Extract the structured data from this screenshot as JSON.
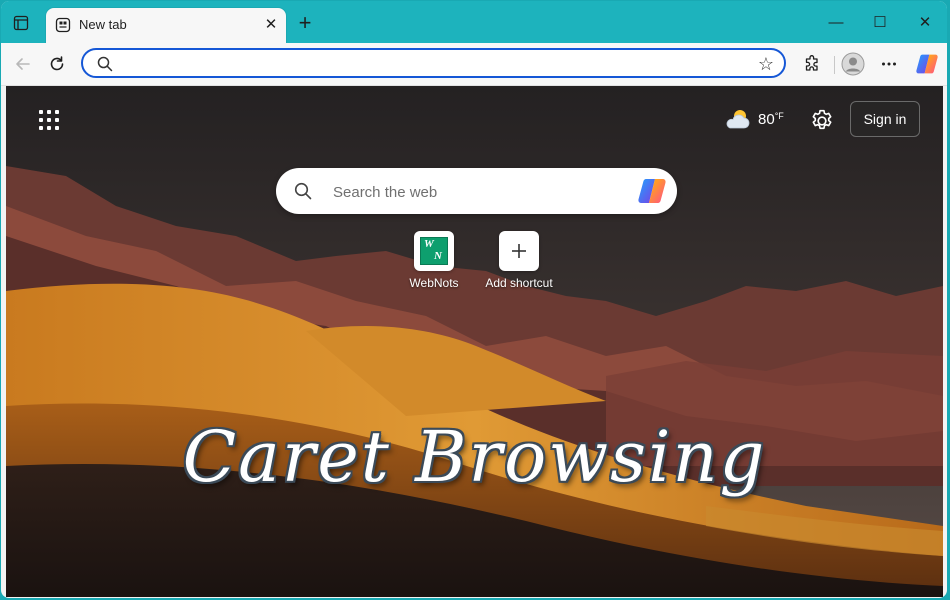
{
  "tab": {
    "title": "New tab",
    "close_symbol": "✕"
  },
  "new_tab_symbol": "+",
  "window_controls": {
    "minimize": "—",
    "maximize": "☐",
    "close": "✕"
  },
  "address_bar": {
    "value": "",
    "placeholder": ""
  },
  "toolbar_icons": [
    "back-arrow-icon",
    "refresh-icon",
    "star-icon",
    "extensions-icon",
    "profile-icon",
    "more-icon",
    "copilot-icon"
  ],
  "new_tab_page": {
    "weather": {
      "temperature": "80",
      "unit": "°F",
      "icon": "partly-cloudy-icon"
    },
    "sign_in_label": "Sign in",
    "search": {
      "placeholder": "Search the web"
    },
    "shortcuts": [
      {
        "label": "WebNots",
        "icon": "webnots-logo"
      },
      {
        "label": "Add shortcut",
        "icon": "plus-icon"
      }
    ],
    "overlay_title": "Caret Browsing"
  },
  "colors": {
    "accent": "#1557d6",
    "titlebar": "#1db3bd",
    "frame": "#19a9b3"
  }
}
